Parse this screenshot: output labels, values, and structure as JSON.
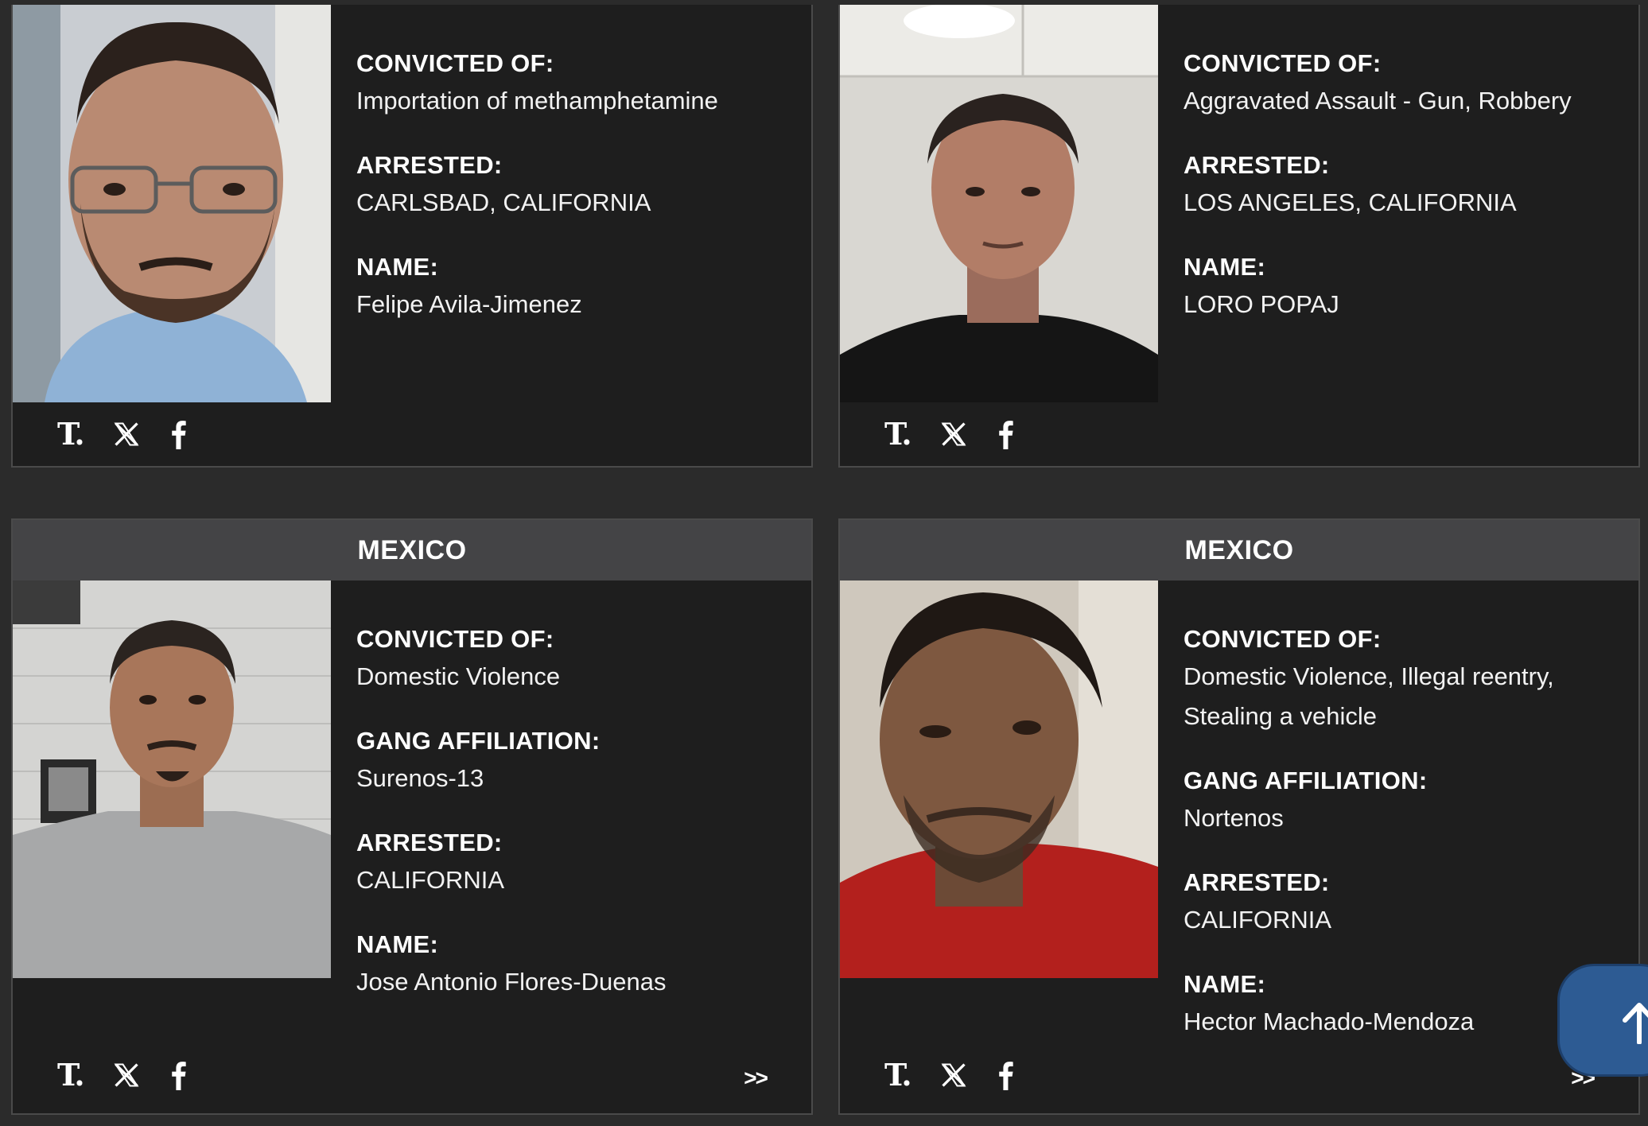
{
  "cards": [
    {
      "country": "",
      "fields": [
        {
          "label": "CONVICTED OF:",
          "value": "Importation of methamphetamine"
        },
        {
          "label": "ARRESTED:",
          "value": "CARLSBAD, CALIFORNIA"
        },
        {
          "label": "NAME:",
          "value": "Felipe Avila-Jimenez"
        }
      ],
      "share_icons": [
        "truth-social-icon",
        "x-icon",
        "facebook-icon"
      ],
      "more_label": ""
    },
    {
      "country": "",
      "fields": [
        {
          "label": "CONVICTED OF:",
          "value": "Aggravated Assault - Gun, Robbery"
        },
        {
          "label": "ARRESTED:",
          "value": "LOS ANGELES, CALIFORNIA"
        },
        {
          "label": "NAME:",
          "value": "LORO POPAJ"
        }
      ],
      "share_icons": [
        "truth-social-icon",
        "x-icon",
        "facebook-icon"
      ],
      "more_label": ""
    },
    {
      "country": "MEXICO",
      "fields": [
        {
          "label": "CONVICTED OF:",
          "value": "Domestic Violence"
        },
        {
          "label": "GANG AFFILIATION:",
          "value": "Surenos-13"
        },
        {
          "label": "ARRESTED:",
          "value": "CALIFORNIA"
        },
        {
          "label": "NAME:",
          "value": "Jose Antonio Flores-Duenas"
        }
      ],
      "share_icons": [
        "truth-social-icon",
        "x-icon",
        "facebook-icon"
      ],
      "more_label": ">>"
    },
    {
      "country": "MEXICO",
      "fields": [
        {
          "label": "CONVICTED OF:",
          "value": "Domestic Violence, Illegal reentry, Stealing a vehicle"
        },
        {
          "label": "GANG AFFILIATION:",
          "value": "Nortenos"
        },
        {
          "label": "ARRESTED:",
          "value": "CALIFORNIA"
        },
        {
          "label": "NAME:",
          "value": "Hector Machado-Mendoza"
        }
      ],
      "share_icons": [
        "truth-social-icon",
        "x-icon",
        "facebook-icon"
      ],
      "more_label": ">>"
    }
  ],
  "share_labels": {
    "truth": "T.",
    "facebook": "f"
  },
  "scroll_top_icon": "arrow-up-icon",
  "colors": {
    "page_bg": "#2b2b2b",
    "card_bg": "#1e1e1e",
    "country_bar_bg": "#444446",
    "scroll_button": "#2d5b93",
    "text": "#ffffff"
  }
}
